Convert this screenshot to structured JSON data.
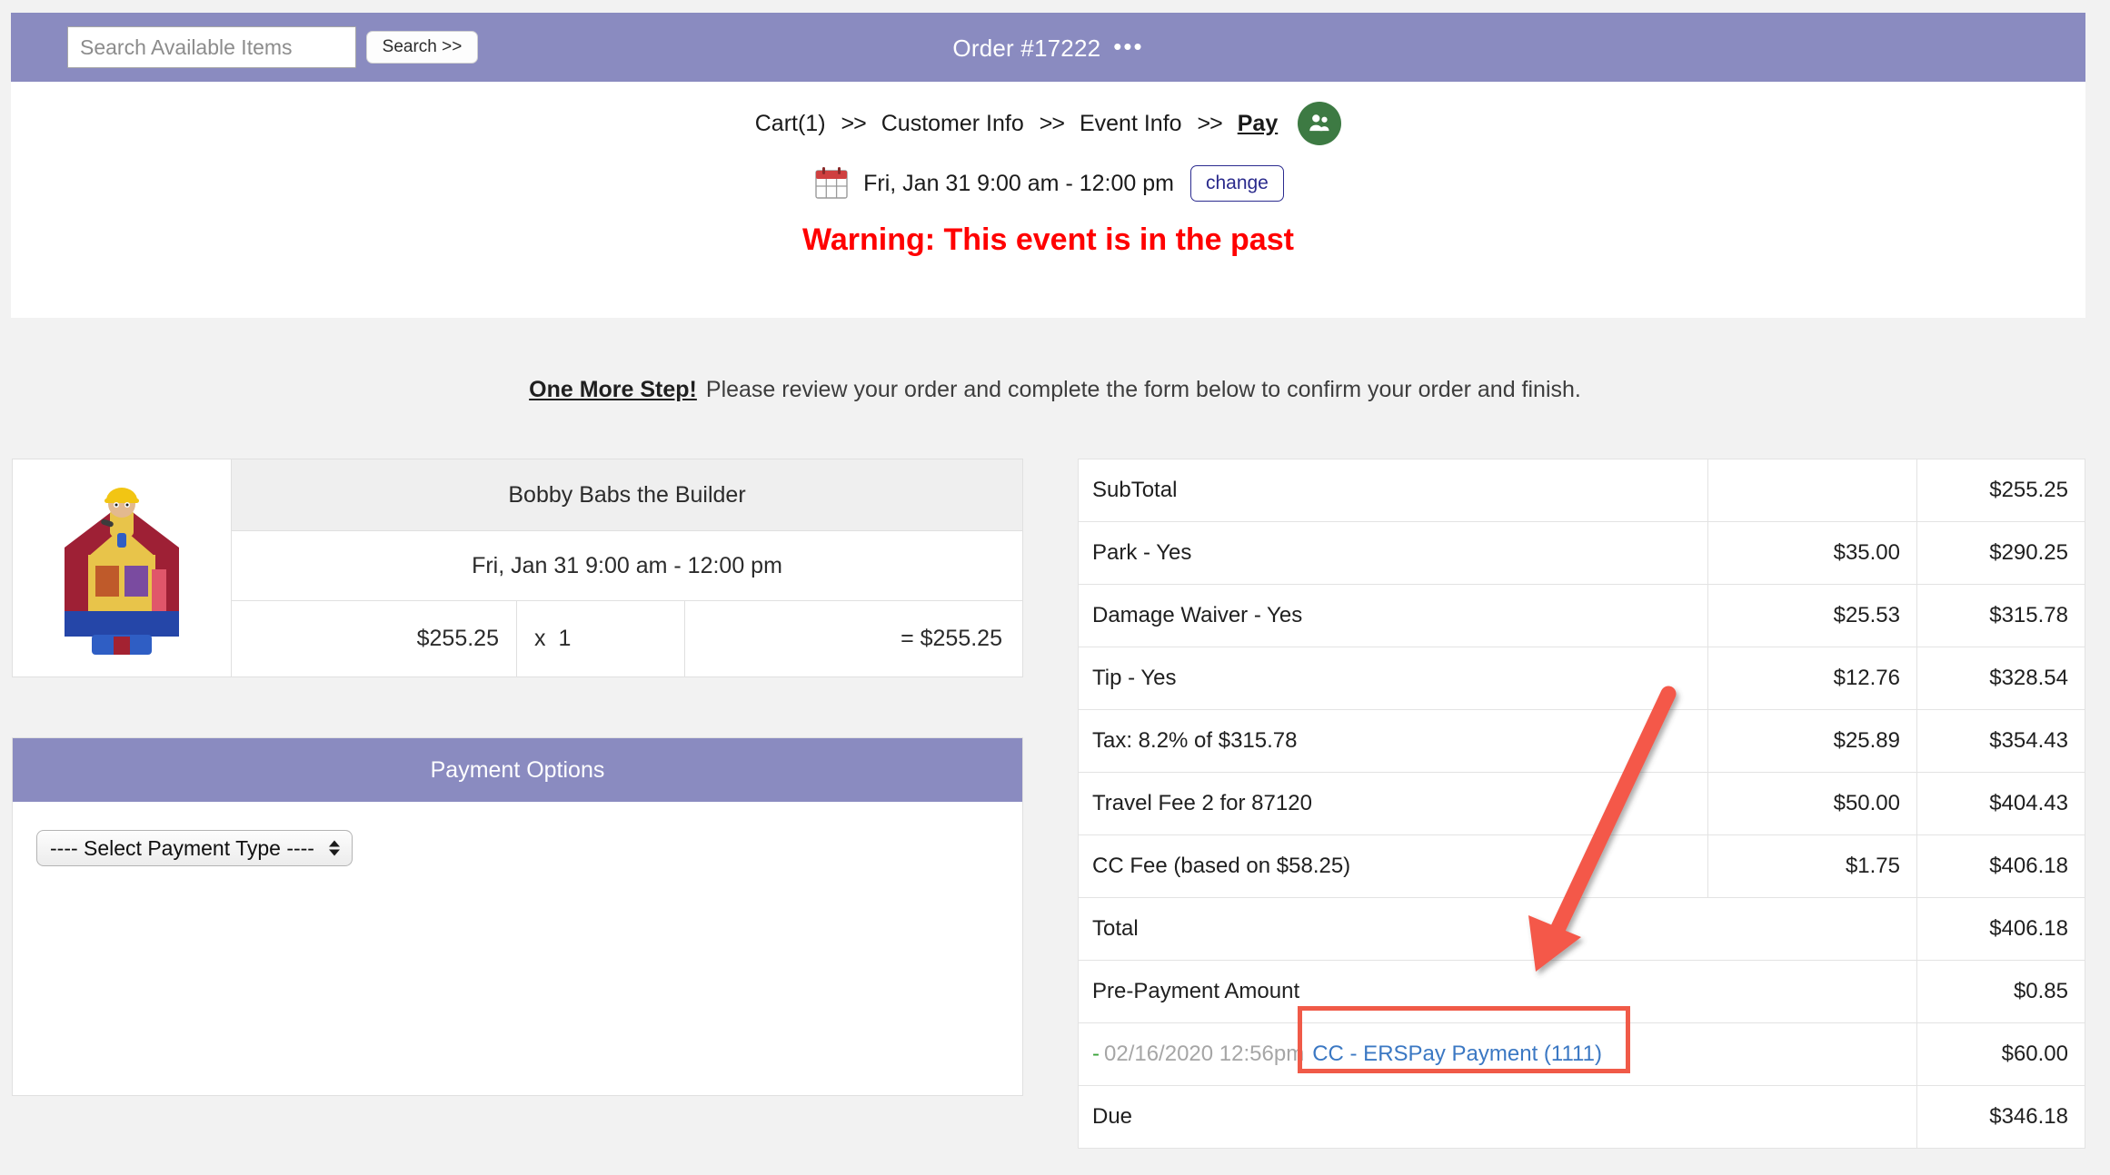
{
  "topbar": {
    "search_placeholder": "Search Available Items",
    "search_value": "",
    "search_button": "Search >>",
    "order_title": "Order #17222",
    "more_dots": "•••"
  },
  "breadcrumb": {
    "steps": [
      {
        "label": "Cart(1)",
        "active": false
      },
      {
        "label": "Customer Info",
        "active": false
      },
      {
        "label": "Event Info",
        "active": false
      },
      {
        "label": "Pay",
        "active": true
      }
    ],
    "separator": ">>",
    "avatar_icon": "users-icon"
  },
  "event": {
    "calendar_icon": "calendar-icon",
    "datetime": "Fri, Jan 31 9:00 am - 12:00 pm",
    "change_button": "change"
  },
  "warning": {
    "text": "Warning: This event is in the past",
    "color": "#ff0000"
  },
  "step_notice": {
    "heading": "One More Step!",
    "body": "Please review your order and complete the form below to confirm your order and finish."
  },
  "item": {
    "image_icon": "bounce-house-image",
    "name": "Bobby Babs the Builder",
    "datetime": "Fri, Jan 31 9:00 am - 12:00 pm",
    "unit_price": "$255.25",
    "qty_label": "x",
    "qty": "1",
    "line_total": "= $255.25"
  },
  "payment_options": {
    "title": "Payment Options",
    "select_value": "---- Select Payment Type ----",
    "select_options": [
      "---- Select Payment Type ----"
    ]
  },
  "summary": {
    "rows": [
      {
        "label": "SubTotal",
        "amount": "",
        "running": "$255.25",
        "type": "normal"
      },
      {
        "label": "Park - Yes",
        "amount": "$35.00",
        "running": "$290.25",
        "type": "normal"
      },
      {
        "label": "Damage Waiver - Yes",
        "amount": "$25.53",
        "running": "$315.78",
        "type": "normal"
      },
      {
        "label": "Tip - Yes",
        "amount": "$12.76",
        "running": "$328.54",
        "type": "normal"
      },
      {
        "label": "Tax: 8.2% of $315.78",
        "amount": "$25.89",
        "running": "$354.43",
        "type": "normal"
      },
      {
        "label": "Travel Fee 2 for 87120",
        "amount": "$50.00",
        "running": "$404.43",
        "type": "normal"
      },
      {
        "label": "CC Fee (based on $58.25)",
        "amount": "$1.75",
        "running": "$406.18",
        "type": "normal"
      },
      {
        "label": "Total",
        "amount": "",
        "running": "$406.18",
        "type": "merged"
      },
      {
        "label": "Pre-Payment Amount",
        "amount": "",
        "running": "$0.85",
        "type": "merged"
      },
      {
        "label": "",
        "amount": "",
        "running": "$60.00",
        "type": "payment",
        "dash": "-",
        "date": "02/16/2020 12:56pm",
        "link": "CC - ERSPay Payment (1111)"
      },
      {
        "label": "Due",
        "amount": "",
        "running": "$346.18",
        "type": "merged"
      }
    ]
  },
  "annotation": {
    "arrow_color": "#f05a48",
    "box_color": "#f05a48",
    "target": "CC - ERSPay Payment (1111)"
  }
}
